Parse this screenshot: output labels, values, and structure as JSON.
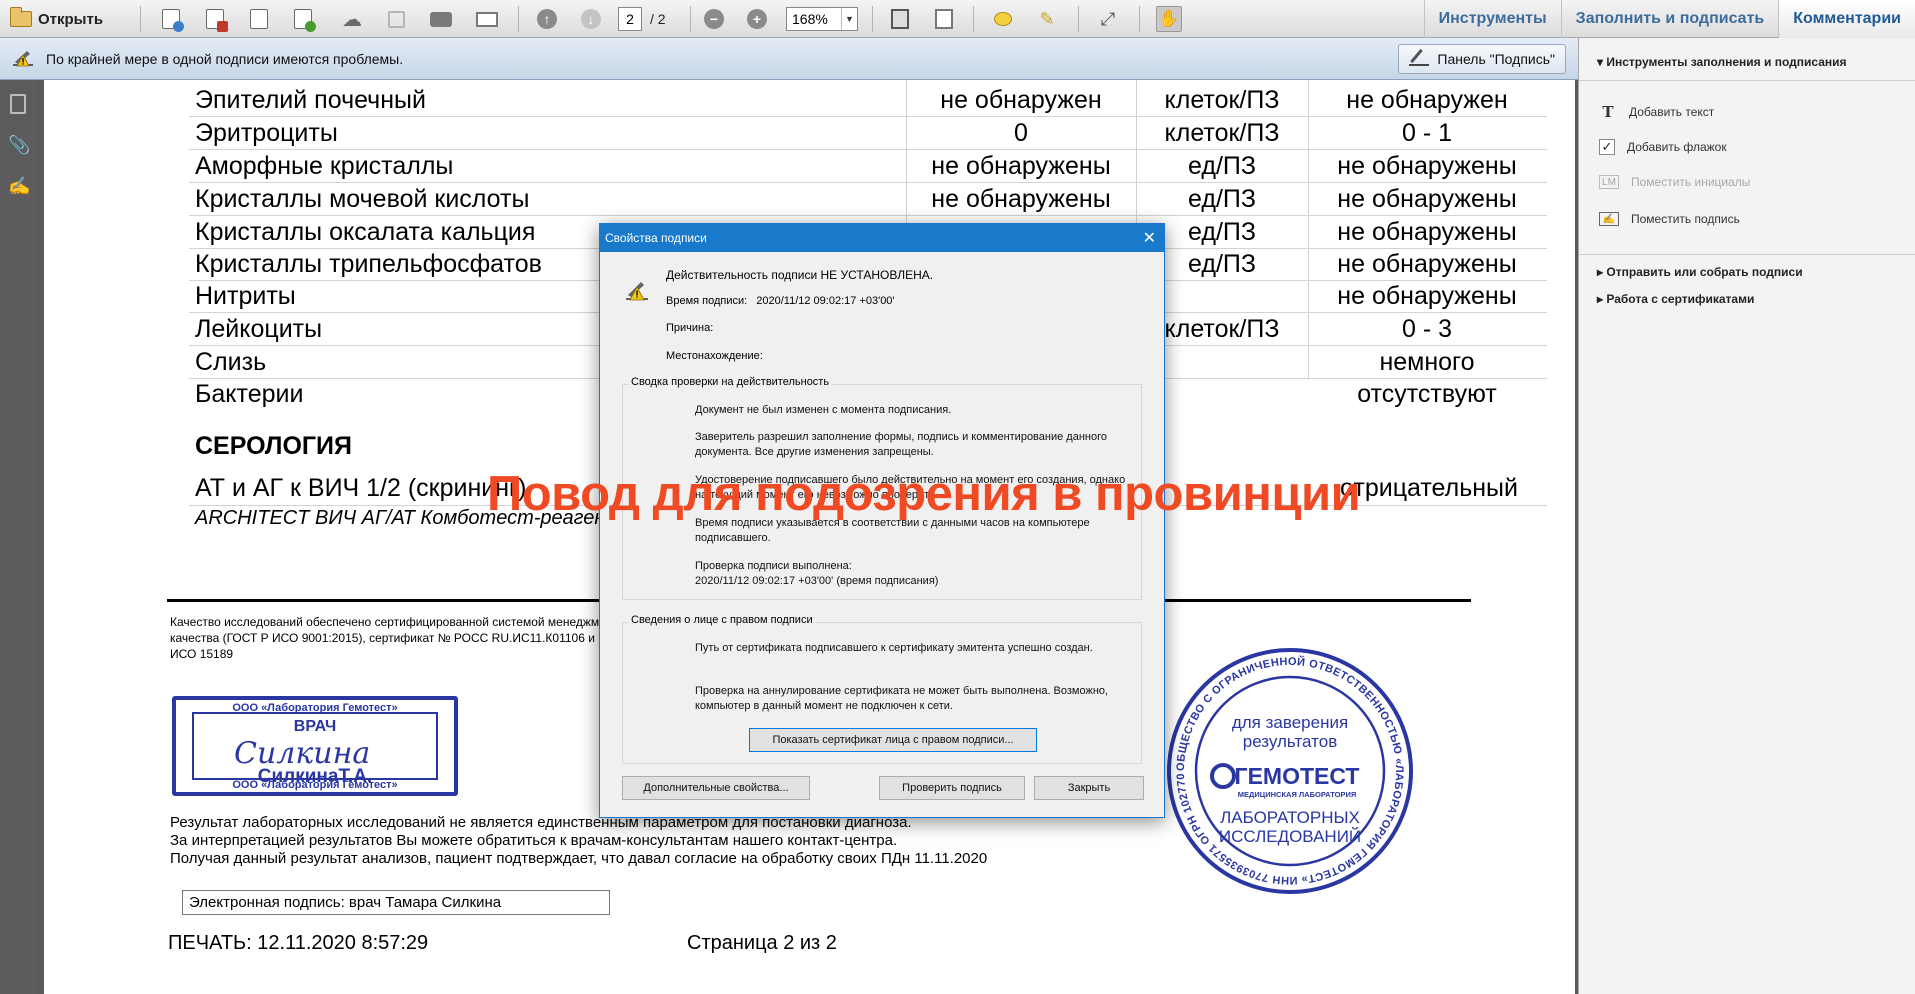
{
  "toolbar": {
    "open_label": "Открыть",
    "page_current": "2",
    "page_total": "/ 2",
    "zoom": "168%",
    "tabs": [
      "Инструменты",
      "Заполнить и подписать",
      "Комментарии"
    ]
  },
  "signature_bar": {
    "message": "По крайней мере в одной подписи имеются проблемы.",
    "panel_button": "Панель \"Подпись\""
  },
  "document": {
    "rows": [
      {
        "name": "Эпителий почечный",
        "result": "не обнаружен",
        "unit": "клеток/ПЗ",
        "norm": "не обнаружен"
      },
      {
        "name": "Эритроциты",
        "result": "0",
        "unit": "клеток/ПЗ",
        "norm": "0 - 1"
      },
      {
        "name": "Аморфные кристаллы",
        "result": "не обнаружены",
        "unit": "ед/ПЗ",
        "norm": "не обнаружены"
      },
      {
        "name": "Кристаллы мочевой кислоты",
        "result": "не обнаружены",
        "unit": "ед/ПЗ",
        "norm": "не обнаружены"
      },
      {
        "name": "Кристаллы оксалата кальция",
        "result": "",
        "unit": "ед/ПЗ",
        "norm": "не обнаружены"
      },
      {
        "name": "Кристаллы трипельфосфатов",
        "result": "",
        "unit": "ед/ПЗ",
        "norm": "не обнаружены"
      },
      {
        "name": "Нитриты",
        "result": "",
        "unit": "",
        "norm": "не обнаружены"
      },
      {
        "name": "Лейкоциты",
        "result": "",
        "unit": "клеток/ПЗ",
        "norm": "0 - 3"
      },
      {
        "name": "Слизь",
        "result": "",
        "unit": "",
        "norm": "немного"
      },
      {
        "name": "Бактерии",
        "result": "",
        "unit": "",
        "norm": "отсутствуют"
      }
    ],
    "section_title": "СЕРОЛОГИЯ",
    "serology_name": "АТ и АГ к ВИЧ 1/2 (скрининг)",
    "serology_result": "отрицательный",
    "architect": "ARCHITECT ВИЧ АГ/АТ Комботест-реагент",
    "quality": "Качество исследований обеспечено сертифицированной системой менеджмента качества (ГОСТ Р ИСО 9001:2015), сертификат № РОСС RU.ИС11.К01106 и ГОСТ Р ИСО 15189",
    "disclaimer_1": "Результат лабораторных исследований не является единственным параметром для постановки диагноза.",
    "disclaimer_2": "За интерпретацией результатов Вы можете обратиться к врачам-консультантам нашего контакт-центра.",
    "disclaimer_3": "Получая данный результат анализов, пациент подтверждает, что давал согласие на обработку своих ПДн 11.11.2020",
    "esignature": "Электронная подпись: врач Тамара Силкина",
    "print_date": "ПЕЧАТЬ: 12.11.2020 8:57:29",
    "page_number": "Страница 2 из 2"
  },
  "doctor_stamp": {
    "top": "ООО «Лаборатория Гемотест»",
    "bottom": "ООО «Лаборатория Гемотест»",
    "side": "Силкина Т.А.",
    "title": "ВРАЧ",
    "signature": "Силкина",
    "name": "СилкинаТ.А."
  },
  "lab_stamp": {
    "ring_text": "ОБЩЕСТВО С ОГРАНИЧЕННОЙ ОТВЕТСТВЕННОСТЬЮ «ЛАБОРАТОРИЯ ГЕМОТЕСТ» ИНН 7703935571 ОГРН 1027700005642 • МОСКВА •",
    "line1": "для заверения",
    "line2": "результатов",
    "brand": "ГЕМОТЕСТ",
    "brand_sub": "МЕДИЦИНСКАЯ ЛАБОРАТОРИЯ",
    "line3": "ЛАБОРАТОРНЫХ",
    "line4": "ИССЛЕДОВАНИЙ"
  },
  "watermark": "Повод для подозрения в провинции",
  "right_panel": {
    "header": "Инструменты заполнения и подписания",
    "items": [
      {
        "label": "Добавить текст",
        "icon": "text-icon",
        "disabled": false
      },
      {
        "label": "Добавить флажок",
        "icon": "checkmark-icon",
        "disabled": false
      },
      {
        "label": "Поместить инициалы",
        "icon": "initials-icon",
        "disabled": true
      },
      {
        "label": "Поместить подпись",
        "icon": "signature-icon",
        "disabled": false
      }
    ],
    "groups": [
      "Отправить или собрать подписи",
      "Работа с сертификатами"
    ]
  },
  "dialog": {
    "title": "Свойства подписи",
    "status": "Действительность подписи НЕ УСТАНОВЛЕНА.",
    "time_label": "Время подписи:",
    "time_value": "2020/11/12 09:02:17 +03'00'",
    "reason_label": "Причина:",
    "location_label": "Местонахождение:",
    "summary_title": "Сводка проверки на действительность",
    "summary_1": "Документ  не был изменен с момента подписания.",
    "summary_2": "Заверитель разрешил заполнение формы, подпись и комментирование данного документа. Все другие изменения запрещены.",
    "summary_3": "Удостоверение подписавшего было действительно на момент его создания, однако на текущий момент его невозможно проверить.",
    "summary_4": "Время подписи указывается в соответствии с данными часов на компьютере подписавшего.",
    "summary_5a": "Проверка подписи выполнена:",
    "summary_5b": "2020/11/12 09:02:17 +03'00' (время подписания)",
    "signer_title": "Сведения о лице с правом подписи",
    "signer_1": "Путь от сертификата подписавшего к сертификату эмитента успешно создан.",
    "signer_2": "Проверка на аннулирование сертификата не может быть выполнена. Возможно, компьютер в данный момент не подключен к сети.",
    "show_cert_button": "Показать сертификат лица с правом подписи...",
    "advanced_button": "Дополнительные свойства...",
    "verify_button": "Проверить подпись",
    "close_button": "Закрыть"
  },
  "colors": {
    "watermark": "#ef4a23",
    "stamp_blue": "#2a37a3",
    "tab_blue": "#3d6c9d",
    "dialog_title": "#1979ca"
  }
}
